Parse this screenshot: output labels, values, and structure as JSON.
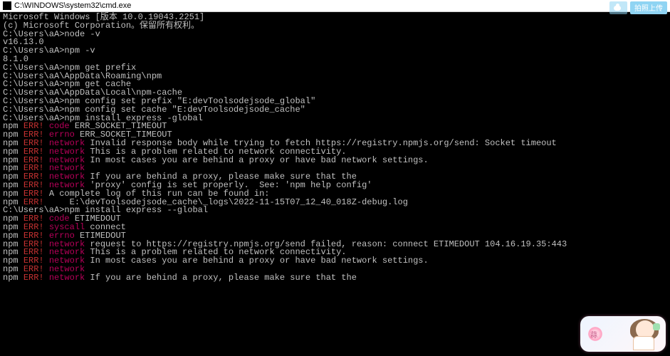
{
  "titlebar": {
    "path": "C:\\WINDOWS\\system32\\cmd.exe",
    "badge1": "",
    "badge2": "拍照上传"
  },
  "t": {
    "l1": "Microsoft Windows [版本 10.0.19043.2251]",
    "l2": "(c) Microsoft Corporation。保留所有权利。",
    "blank": "",
    "p1a": "C:\\Users\\aA>node -v",
    "p1b": "v16.13.0",
    "p2a": "C:\\Users\\aA>npm -v",
    "p2b": "8.1.0",
    "p3a": "C:\\Users\\aA>npm get prefix",
    "p3b": "C:\\Users\\aA\\AppData\\Roaming\\npm",
    "p4a": "C:\\Users\\aA>npm get cache",
    "p4b": "C:\\Users\\aA\\AppData\\Local\\npm-cache",
    "p5": "C:\\Users\\aA>npm config set prefix \"E:devToolsodejsode_global\"",
    "p6": "C:\\Users\\aA>npm config set cache \"E:devToolsodejsode_cache\"",
    "p7": "C:\\Users\\aA>npm install express -global",
    "npm": "npm ",
    "err": "ERR!",
    "code": " code",
    "errno": " errno",
    "network": " network",
    "e1v": " ERR_SOCKET_TIMEOUT",
    "e2v": " ERR_SOCKET_TIMEOUT",
    "e3v": " Invalid response body while trying to fetch https://registry.npmjs.org/send: Socket timeout",
    "e4v": " This is a problem related to network connectivity.",
    "e5v": " In most cases you are behind a proxy or have bad network settings.",
    "e7v": " If you are behind a proxy, please make sure that the",
    "e8v": " 'proxy' config is set properly.  See: 'npm help config'",
    "log1": " A complete log of this run can be found in:",
    "log2": "     E:\\devToolsodejsode_cache\\_logs\\2022-11-15T07_12_40_018Z-debug.log",
    "p8": "C:\\Users\\aA>npm install express --global",
    "syscall": " syscall",
    "f1v": " ETIMEDOUT",
    "f2v": " connect",
    "f3v": " ETIMEDOUT",
    "f4v": " request to https://registry.npmjs.org/send failed, reason: connect ETIMEDOUT 104.16.19.35:443"
  },
  "mascot": {
    "label": "蒜"
  }
}
